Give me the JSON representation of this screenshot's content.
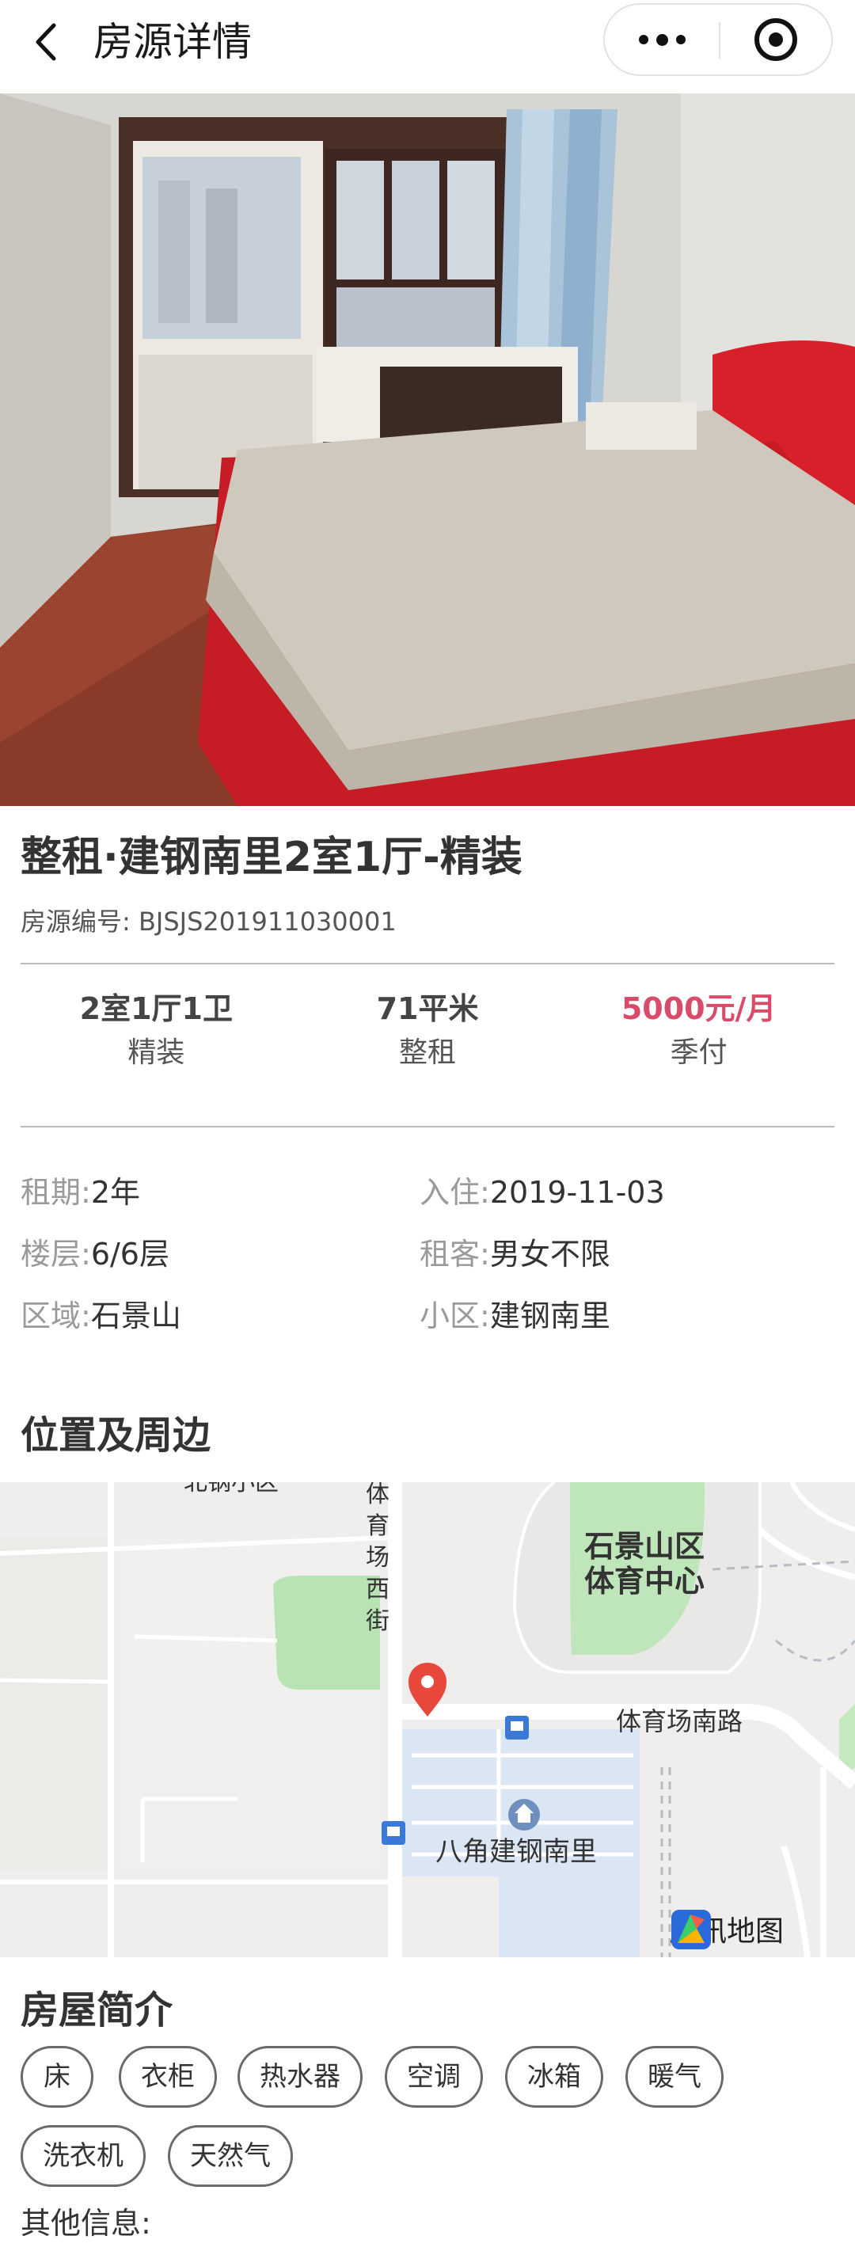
{
  "nav": {
    "title": "房源详情"
  },
  "gallery": {
    "dot_count": 6,
    "active_index": 2
  },
  "house": {
    "title": "整租·建钢南里2室1厅-精装",
    "code": "房源编号: BJSJS201911030001"
  },
  "summary": [
    {
      "main": "2室1厅1卫",
      "sub": "精装"
    },
    {
      "main": "71平米",
      "sub": "整租"
    },
    {
      "main": "5000元/月",
      "sub": "季付"
    }
  ],
  "details": {
    "lease_label": "租期:",
    "lease_value": "2年",
    "movein_label": "入住:",
    "movein_value": "2019-11-03",
    "floor_label": "楼层:",
    "floor_value": "6/6层",
    "tenant_label": "租客:",
    "tenant_value": "男女不限",
    "district_label": "区域:",
    "district_value": "石景山",
    "community_label": "小区:",
    "community_value": "建钢南里"
  },
  "location": {
    "section_title": "位置及周边"
  },
  "map": {
    "label_beigang": "北钢小区",
    "label_street": "体育场西街",
    "label_stadium_line1": "石景山区",
    "label_stadium_line2": "体育中心",
    "label_south_road": "体育场南路",
    "label_community": "八角建钢南里",
    "logo_text": "腾讯地图",
    "pin_color": "#e8483c"
  },
  "intro": {
    "section_title": "房屋简介",
    "tags": [
      "床",
      "衣柜",
      "热水器",
      "空调",
      "冰箱",
      "暖气",
      "洗衣机",
      "天然气"
    ],
    "other_label": "其他信息:"
  },
  "colors": {
    "price": "#d94b6a"
  }
}
